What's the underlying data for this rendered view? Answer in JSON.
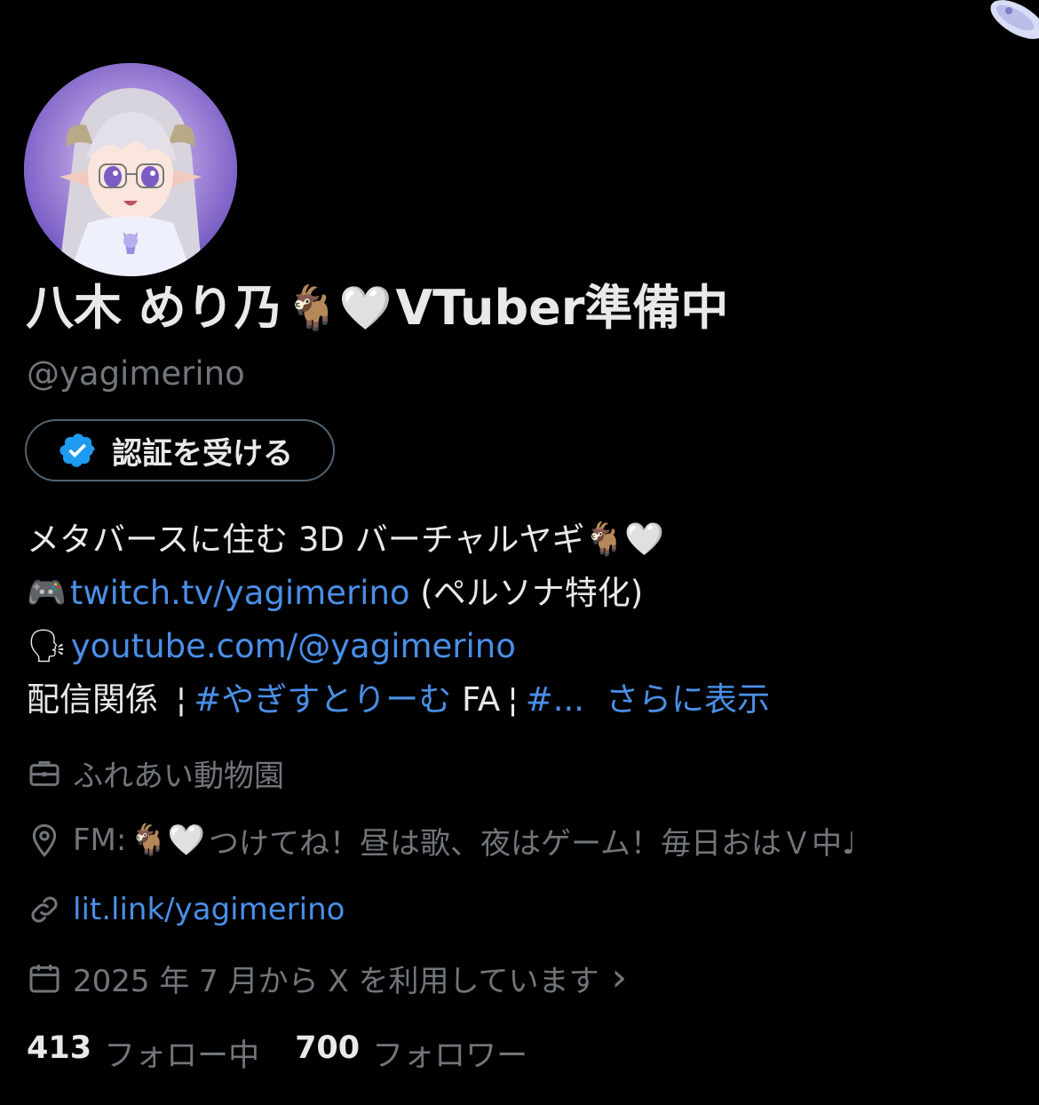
{
  "profile": {
    "display_name_part1": "八木 めり乃",
    "display_name_emoji": "🐐🤍",
    "display_name_part2": "VTuber準備中",
    "handle": "@yagimerino",
    "verify_button": "認証を受ける"
  },
  "bio": {
    "line1_text": "メタバースに住む 3D バーチャルヤギ",
    "line1_emoji": "🐐🤍",
    "line2_emoji": "🎮",
    "line2_link": "twitch.tv/yagimerino",
    "line2_suffix": " (ペルソナ特化)",
    "line3_emoji": "🗣",
    "line3_link": "youtube.com/@yagimerino",
    "line4_text": "配信関係 ",
    "line4_sep1": "¦",
    "line4_hashtag": "#やぎすとりーむ",
    "line4_mid": " FA",
    "line4_sep2": "¦",
    "line4_hash2": "#...",
    "show_more": "さらに表示"
  },
  "meta": {
    "category": "ふれあい動物園",
    "location_prefix": "FM:",
    "location_emoji": "🐐🤍",
    "location_text": "つけてね！昼は歌、夜はゲーム！毎日おはＶ中♩",
    "website": "lit.link/yagimerino",
    "joined": "2025 年 7 月から X を利用しています",
    "joined_chevron": "›"
  },
  "stats": {
    "following_count": "413",
    "following_label": "フォロー中",
    "followers_count": "700",
    "followers_label": "フォロワー"
  },
  "colors": {
    "background": "#000000",
    "text": "#e7e9ea",
    "muted": "#71767b",
    "link": "#4a8fe7",
    "verified": "#1d9bf0"
  }
}
